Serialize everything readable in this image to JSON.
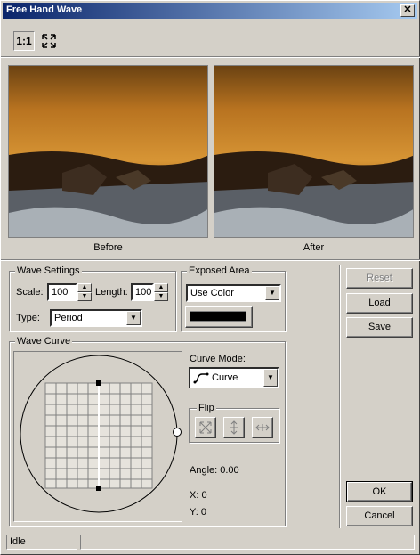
{
  "window": {
    "title": "Free Hand Wave",
    "close_glyph": "✕"
  },
  "toolbar": {
    "zoom_label": "1:1",
    "fit_icon": "fit-to-window-icon"
  },
  "previews": {
    "before_label": "Before",
    "after_label": "After"
  },
  "wave_settings": {
    "title": "Wave Settings",
    "scale_label": "Scale:",
    "scale_value": "100",
    "length_label": "Length:",
    "length_value": "100",
    "type_label": "Type:",
    "type_value": "Period"
  },
  "exposed_area": {
    "title": "Exposed Area",
    "mode_value": "Use Color",
    "swatch_color": "#000000"
  },
  "buttons": {
    "reset": "Reset",
    "load": "Load",
    "save": "Save",
    "ok": "OK",
    "cancel": "Cancel"
  },
  "wave_curve": {
    "title": "Wave Curve",
    "curve_mode_label": "Curve Mode:",
    "curve_mode_value": "Curve",
    "flip_title": "Flip",
    "angle_text": "Angle: 0.00",
    "x_text": "X: 0",
    "y_text": "Y: 0"
  },
  "status": {
    "text": "Idle"
  }
}
